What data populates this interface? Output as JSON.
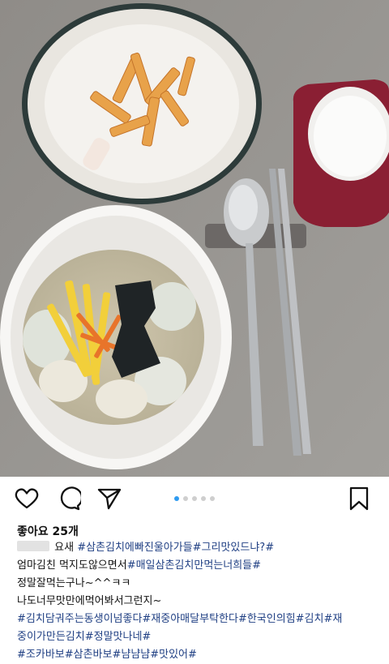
{
  "post": {
    "likes_text": "좋아요 25개",
    "caption_lines": [
      {
        "head": " 요새",
        "tags": " #삼촌김치에빠진울아가들#그리맛있드냐?#",
        "tail": ""
      },
      {
        "head": "엄마김친 먹지도않으면서",
        "tags": "#매일삼촌김치만먹는너희들#",
        "tail": ""
      },
      {
        "head": "정말잘먹는구나~^^ㅋㅋ",
        "tags": "",
        "tail": ""
      },
      {
        "head": "나도너무맛만에먹어봐서그런지~",
        "tags": "",
        "tail": ""
      },
      {
        "head": "",
        "tags": "#김치담궈주는동생이넘좋다#재중아매달부탁한다#한국인의힘#김치#재",
        "tail": ""
      },
      {
        "head": "",
        "tags": "중이가만든김치#정말맛나네#",
        "tail": ""
      },
      {
        "head": "",
        "tags": "#조카바보#삼촌바보#냠냠냠#맛있어#",
        "tail": ""
      }
    ]
  },
  "carousel": {
    "count": 5,
    "active_index": 0,
    "active_color": "#2f9bf0",
    "inactive_color": "#cfcfcf"
  },
  "icons": {
    "like": "heart-icon",
    "comment": "comment-icon",
    "share": "send-icon",
    "save": "bookmark-icon"
  }
}
